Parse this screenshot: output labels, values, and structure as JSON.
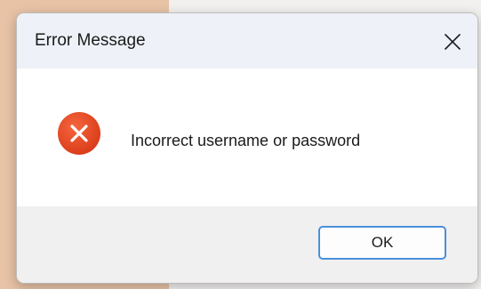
{
  "dialog": {
    "title": "Error Message",
    "message": "Incorrect username or password",
    "ok_label": "OK"
  },
  "icons": {
    "close": "close-icon",
    "error": "error-icon"
  },
  "colors": {
    "error_icon_fill": "#e8431f",
    "button_border": "#4a8fdc",
    "titlebar_bg": "#eef1f8",
    "footer_bg": "#f0f0f0"
  }
}
